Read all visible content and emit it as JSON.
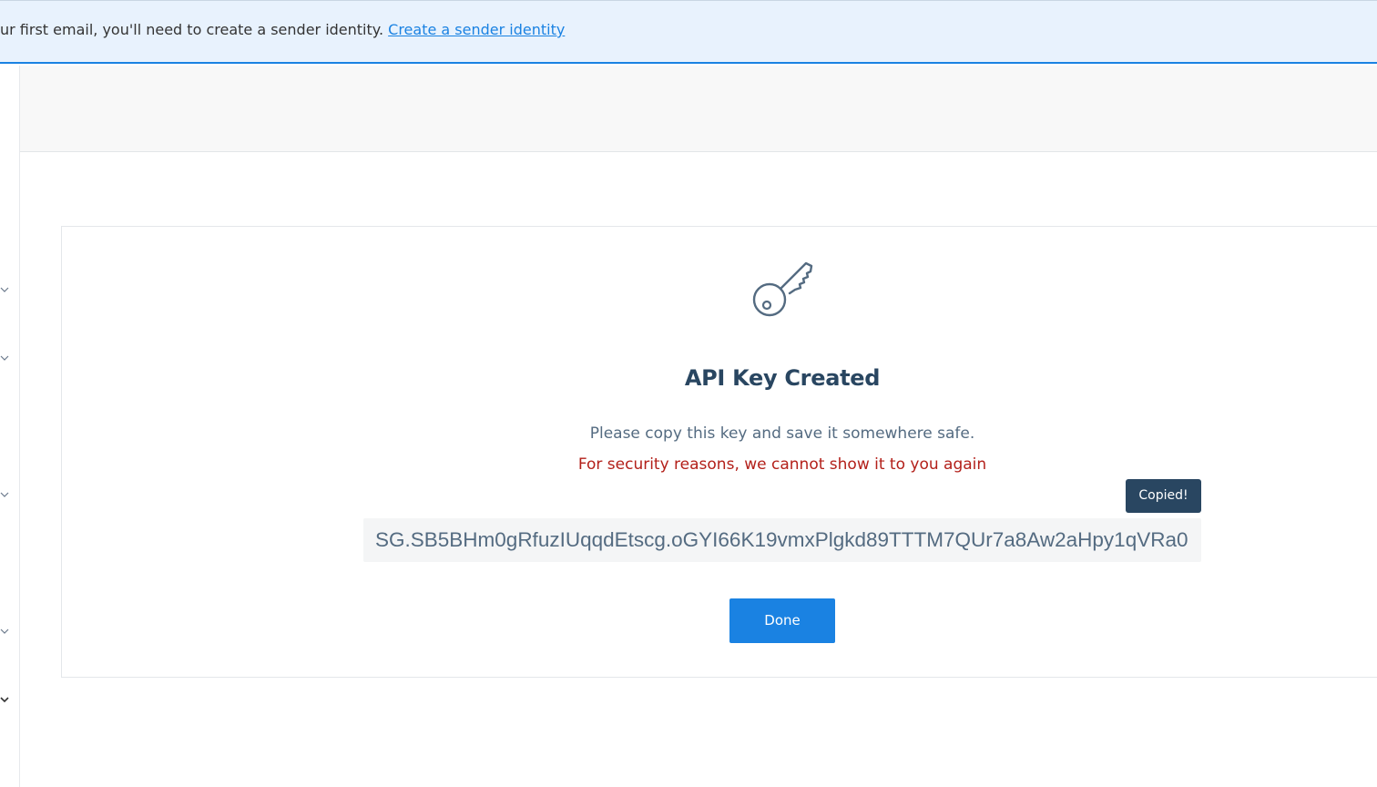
{
  "banner": {
    "text": "ur first email, you'll need to create a sender identity. ",
    "link_label": "Create a sender identity"
  },
  "sidebar": {
    "chevrons": [
      "chevron-down-icon",
      "chevron-down-icon",
      "chevron-down-icon",
      "chevron-down-icon",
      "chevron-down-icon"
    ]
  },
  "modal": {
    "icon": "key-icon",
    "title": "API Key Created",
    "subtitle": "Please copy this key and save it somewhere safe.",
    "warning": "For security reasons, we cannot show it to you again",
    "tooltip": "Copied!",
    "api_key": "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",
    "done_label": "Done"
  },
  "colors": {
    "accent": "#1a82e2",
    "heading": "#294661",
    "warning": "#b3201a",
    "banner_bg": "#e8f2fd"
  }
}
